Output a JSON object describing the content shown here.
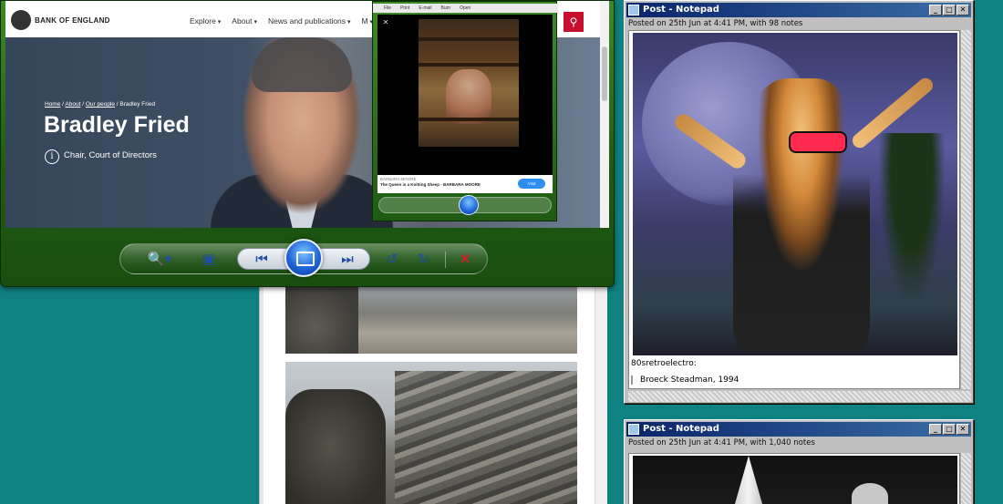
{
  "viewer": {
    "nav": {
      "org_name": "BANK OF ENGLAND",
      "menu": [
        "Explore",
        "About",
        "News and publications",
        "M"
      ]
    },
    "hero": {
      "breadcrumb": [
        "Home",
        "About",
        "Our people",
        "Bradley Fried"
      ],
      "name": "Bradley Fried",
      "role": "Chair, Court of Directors"
    },
    "toolbar": {
      "zoom_icon": "zoom-icon",
      "fit_icon": "fit-window-icon",
      "prev_icon": "previous-icon",
      "slideshow_icon": "slideshow-icon",
      "next_icon": "next-icon",
      "rotate_ccw_icon": "rotate-counterclockwise-icon",
      "rotate_cw_icon": "rotate-clockwise-icon",
      "delete_icon": "delete-icon"
    }
  },
  "mini_viewer": {
    "menu": [
      "File",
      "Print",
      "E-mail",
      "Burn",
      "Open"
    ],
    "author": "BARBARA MOORE",
    "title": "The Queen is a Knitting Sheep - BARBARA MOORE",
    "visit_label": "Visit"
  },
  "notepad_1": {
    "title": "Post - Notepad",
    "meta": "Posted on 25th Jun at 4:41 PM, with 98 notes",
    "caption": "80sretroelectro:",
    "quote": "Broeck Steadman, 1994"
  },
  "notepad_2": {
    "title": "Post - Notepad",
    "meta": "Posted on 25th Jun at 4:41 PM, with 1,040 notes"
  },
  "colors": {
    "desktop": "#0f8181",
    "boe_red": "#c8102e",
    "viewer_green": "#1f5a13",
    "titlebar_blue": "#0a246a"
  }
}
